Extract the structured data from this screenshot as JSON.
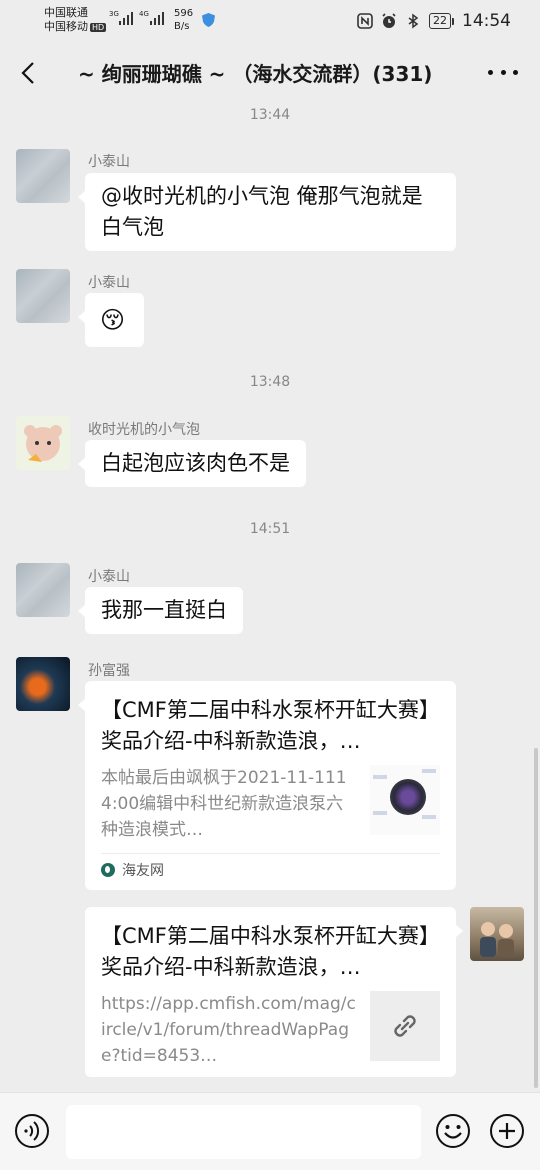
{
  "status_bar": {
    "carrier1": "中国联通",
    "carrier2": "中国移动",
    "hd": "HD",
    "net1": "3G",
    "net2": "4G",
    "speed_value": "596",
    "speed_unit": "B/s",
    "battery": "22",
    "time": "14:54"
  },
  "header": {
    "title": "~ 绚丽珊瑚礁 ~ （海水交流群）(331)"
  },
  "chat": {
    "timestamps": [
      "13:44",
      "13:48",
      "14:51"
    ],
    "messages": [
      {
        "sender": "小泰山",
        "text": "@收时光机的小气泡  俺那气泡就是白气泡"
      },
      {
        "sender": "小泰山",
        "emoji": "😚"
      },
      {
        "sender": "收时光机的小气泡",
        "text": "白起泡应该肉色不是"
      },
      {
        "sender": "小泰山",
        "text": "我那一直挺白"
      },
      {
        "sender": "孙富强",
        "card_title": "【CMF第二届中科水泵杯开缸大赛】奖品介绍-中科新款造浪，…",
        "card_desc": "本帖最后由飒枫于2021-11-1114:00编辑中科世纪新款造浪泵六种造浪模式…",
        "card_source": "海友网"
      },
      {
        "sender": "me",
        "card_title": "【CMF第二届中科水泵杯开缸大赛】奖品介绍-中科新款造浪，…",
        "card_desc": "https://app.cmfish.com/mag/circle/v1/forum/threadWapPage?tid=8453…"
      }
    ]
  },
  "input_bar": {
    "placeholder": ""
  },
  "icons": {
    "back": "chevron-left-icon",
    "more": "more-icon",
    "voice": "voice-icon",
    "emoji": "emoji-icon",
    "plus": "plus-icon",
    "link": "link-icon"
  }
}
